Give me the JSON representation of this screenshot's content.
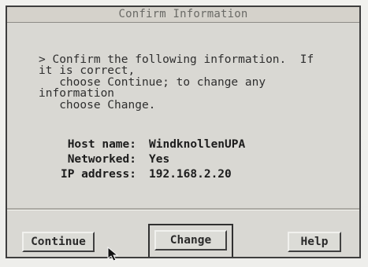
{
  "window": {
    "title": "Confirm Information"
  },
  "message": "> Confirm the following information.  If\nit is correct,\n   choose Continue; to change any\ninformation\n   choose Change.",
  "fields": [
    {
      "label": "Host name:",
      "value": "WindknollenUPA"
    },
    {
      "label": "Networked:",
      "value": "Yes"
    },
    {
      "label": "IP address:",
      "value": "192.168.2.20"
    }
  ],
  "buttons": {
    "continue": "Continue",
    "change": "Change",
    "help": "Help"
  },
  "icons": {
    "pointer": "mouse-pointer-icon"
  },
  "colors": {
    "background": "#f2f2f0",
    "dialog": "#d9d8d3",
    "text": "#2f2f2f"
  }
}
